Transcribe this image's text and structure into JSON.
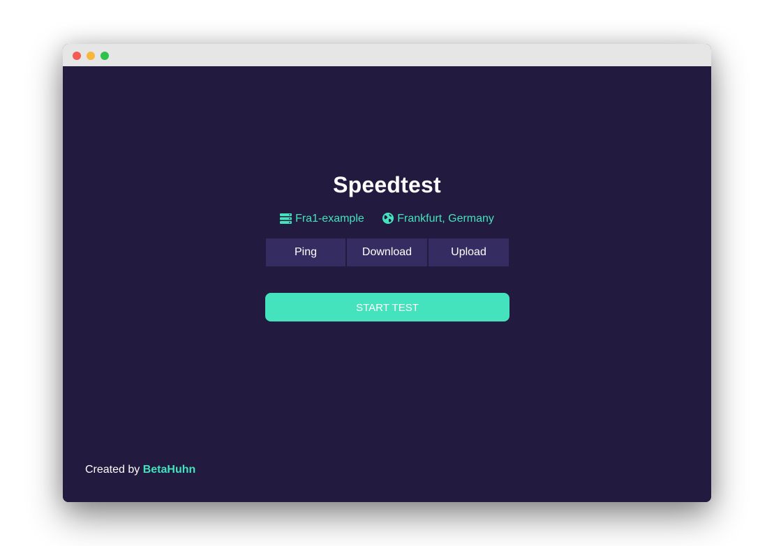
{
  "window": {
    "controls": [
      "close",
      "minimize",
      "maximize"
    ]
  },
  "app": {
    "title": "Speedtest"
  },
  "server": {
    "name": "Fra1-example",
    "name_icon": "server-icon",
    "location": "Frankfurt, Germany",
    "location_icon": "globe-icon"
  },
  "tabs": [
    {
      "label": "Ping"
    },
    {
      "label": "Download"
    },
    {
      "label": "Upload"
    }
  ],
  "actions": {
    "start_label": "START TEST"
  },
  "footer": {
    "prefix": "Created by",
    "author": "BetaHuhn"
  },
  "colors": {
    "background": "#231a3f",
    "accent": "#45e3bd",
    "tab_background": "#352c61",
    "titlebar": "#e6e6e6"
  }
}
